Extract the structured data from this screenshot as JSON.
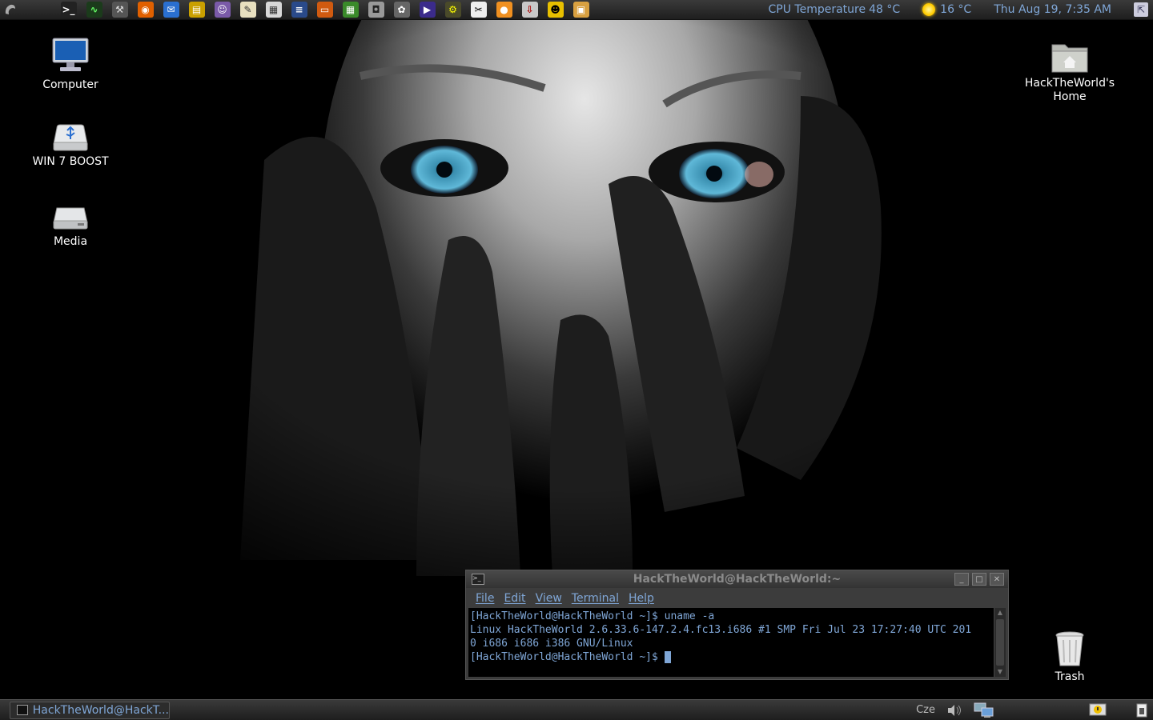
{
  "top_panel": {
    "launchers": [
      {
        "name": "terminal-launcher",
        "icon": "terminal-icon",
        "bg": "#222",
        "fg": "#fff",
        "glyph": ">_"
      },
      {
        "name": "system-monitor-launcher",
        "icon": "system-monitor-icon",
        "bg": "#1b3b1b",
        "fg": "#6f6",
        "glyph": "∿"
      },
      {
        "name": "tools-launcher",
        "icon": "hammer-icon",
        "bg": "#555",
        "fg": "#ddd",
        "glyph": "⚒"
      },
      {
        "name": "firefox-launcher",
        "icon": "firefox-icon",
        "bg": "#e06000",
        "fg": "#fff",
        "glyph": "◉"
      },
      {
        "name": "thunderbird-launcher",
        "icon": "thunderbird-icon",
        "bg": "#2a6fd0",
        "fg": "#fff",
        "glyph": "✉"
      },
      {
        "name": "file-manager-launcher",
        "icon": "folder-icon",
        "bg": "#c9a000",
        "fg": "#fff",
        "glyph": "▤"
      },
      {
        "name": "pidgin-launcher",
        "icon": "pidgin-icon",
        "bg": "#7a5aa8",
        "fg": "#fff",
        "glyph": "☺"
      },
      {
        "name": "text-editor-launcher",
        "icon": "text-editor-icon",
        "bg": "#e8e0c0",
        "fg": "#333",
        "glyph": "✎"
      },
      {
        "name": "calculator-launcher",
        "icon": "calculator-icon",
        "bg": "#d8d8d8",
        "fg": "#333",
        "glyph": "▦"
      },
      {
        "name": "document-launcher",
        "icon": "document-icon",
        "bg": "#2a4a8a",
        "fg": "#fff",
        "glyph": "≡"
      },
      {
        "name": "presentation-launcher",
        "icon": "presentation-icon",
        "bg": "#d05a10",
        "fg": "#fff",
        "glyph": "▭"
      },
      {
        "name": "spreadsheet-launcher",
        "icon": "spreadsheet-icon",
        "bg": "#3a8a2a",
        "fg": "#fff",
        "glyph": "▦"
      },
      {
        "name": "screenshot-launcher",
        "icon": "camera-icon",
        "bg": "#999",
        "fg": "#222",
        "glyph": "◘"
      },
      {
        "name": "gimp-launcher",
        "icon": "gimp-icon",
        "bg": "#666",
        "fg": "#fff",
        "glyph": "✿"
      },
      {
        "name": "media-player-launcher",
        "icon": "media-player-icon",
        "bg": "#3b2b8b",
        "fg": "#fff",
        "glyph": "▶"
      },
      {
        "name": "network-launcher",
        "icon": "network-icon",
        "bg": "#4a4a2a",
        "fg": "#ff0",
        "glyph": "⚙"
      },
      {
        "name": "video-editor-launcher",
        "icon": "film-icon",
        "bg": "#eee",
        "fg": "#000",
        "glyph": "✂"
      },
      {
        "name": "burner-launcher",
        "icon": "disc-burner-icon",
        "bg": "#f09020",
        "fg": "#fff",
        "glyph": "●"
      },
      {
        "name": "installer-launcher",
        "icon": "package-icon",
        "bg": "#c8c8c8",
        "fg": "#a00",
        "glyph": "⇩"
      },
      {
        "name": "tux-launcher",
        "icon": "tux-icon",
        "bg": "#e8c000",
        "fg": "#000",
        "glyph": "☻"
      },
      {
        "name": "archive-launcher",
        "icon": "archive-icon",
        "bg": "#d8a040",
        "fg": "#fff",
        "glyph": "▣"
      }
    ],
    "cpu_label": "CPU Temperature",
    "cpu_value": "48 °C",
    "weather": "16 °C",
    "clock": "Thu Aug 19,  7:35 AM"
  },
  "desktop": {
    "computer": "Computer",
    "usb": "WIN 7 BOOST",
    "media": "Media",
    "home": "HackTheWorld's Home",
    "trash": "Trash"
  },
  "terminal": {
    "title": "HackTheWorld@HackTheWorld:~",
    "menus": [
      "File",
      "Edit",
      "View",
      "Terminal",
      "Help"
    ],
    "lines": [
      "[HackTheWorld@HackTheWorld ~]$ uname -a",
      "Linux HackTheWorld 2.6.33.6-147.2.4.fc13.i686 #1 SMP Fri Jul 23 17:27:40 UTC 201",
      "0 i686 i686 i386 GNU/Linux"
    ],
    "prompt": "[HackTheWorld@HackTheWorld ~]$ "
  },
  "bottom_panel": {
    "task": "HackTheWorld@HackT...",
    "keyboard": "Cze"
  },
  "colors": {
    "accent": "#7fa6d6",
    "panel": "#2a2a2a"
  }
}
